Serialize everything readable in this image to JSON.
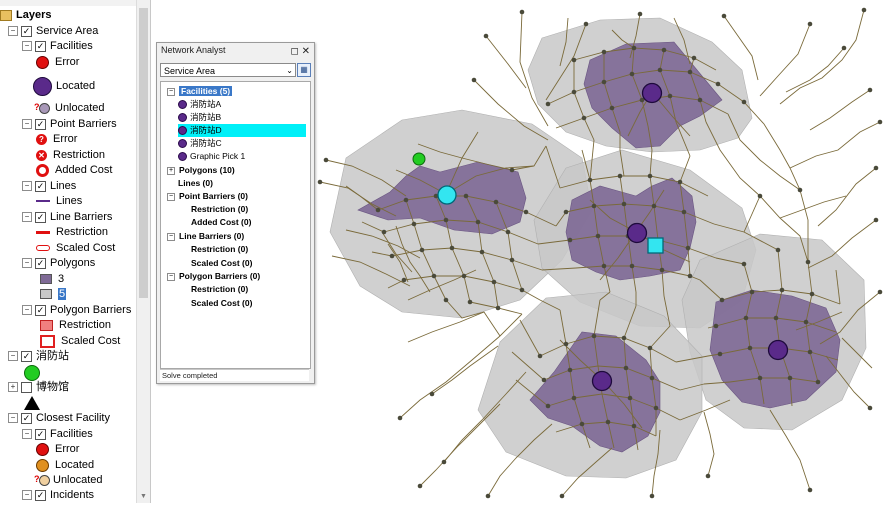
{
  "toc": {
    "title": "Layers",
    "service_area": "Service Area",
    "facilities": "Facilities",
    "fac_error": "Error",
    "fac_located": "Located",
    "fac_unlocated": "Unlocated",
    "point_barriers": "Point Barriers",
    "pb_error": "Error",
    "pb_restriction": "Restriction",
    "pb_added_cost": "Added Cost",
    "lines": "Lines",
    "lines_item": "Lines",
    "line_barriers": "Line Barriers",
    "lb_restriction": "Restriction",
    "lb_scaled_cost": "Scaled Cost",
    "polygons": "Polygons",
    "poly_3": "3",
    "poly_5": "5",
    "polygon_barriers": "Polygon Barriers",
    "pgb_restriction": "Restriction",
    "pgb_scaled_cost": "Scaled Cost",
    "fire_station": "消防站",
    "museum": "博物馆",
    "closest_facility": "Closest Facility",
    "cf_facilities": "Facilities",
    "cf_error": "Error",
    "cf_located": "Located",
    "cf_unlocated": "Unlocated",
    "cf_incidents": "Incidents"
  },
  "na": {
    "title": "Network Analyst",
    "combo": "Service Area",
    "facilities": "Facilities (5)",
    "fac_items": [
      "消防站A",
      "消防站B",
      "消防站D",
      "消防站C",
      "Graphic Pick 1"
    ],
    "polygons": "Polygons (10)",
    "lines": "Lines (0)",
    "point_barriers": "Point Barriers (0)",
    "pb_restriction": "Restriction (0)",
    "pb_added_cost": "Added Cost (0)",
    "line_barriers": "Line Barriers (0)",
    "lb_restriction": "Restriction (0)",
    "lb_scaled_cost": "Scaled Cost (0)",
    "polygon_barriers": "Polygon Barriers (0)",
    "pgb_restriction": "Restriction (0)",
    "pgb_scaled_cost": "Scaled Cost (0)",
    "status": "Solve completed"
  },
  "colors": {
    "facility": "#5a2a8a",
    "inner_polygon": "#7f6a96",
    "outer_polygon": "#c8c8c8",
    "road": "#7a6a3a",
    "selected_row": "#00f0f8",
    "fire_station": "#22cc22",
    "graphic_pick": "#33e5f0"
  }
}
